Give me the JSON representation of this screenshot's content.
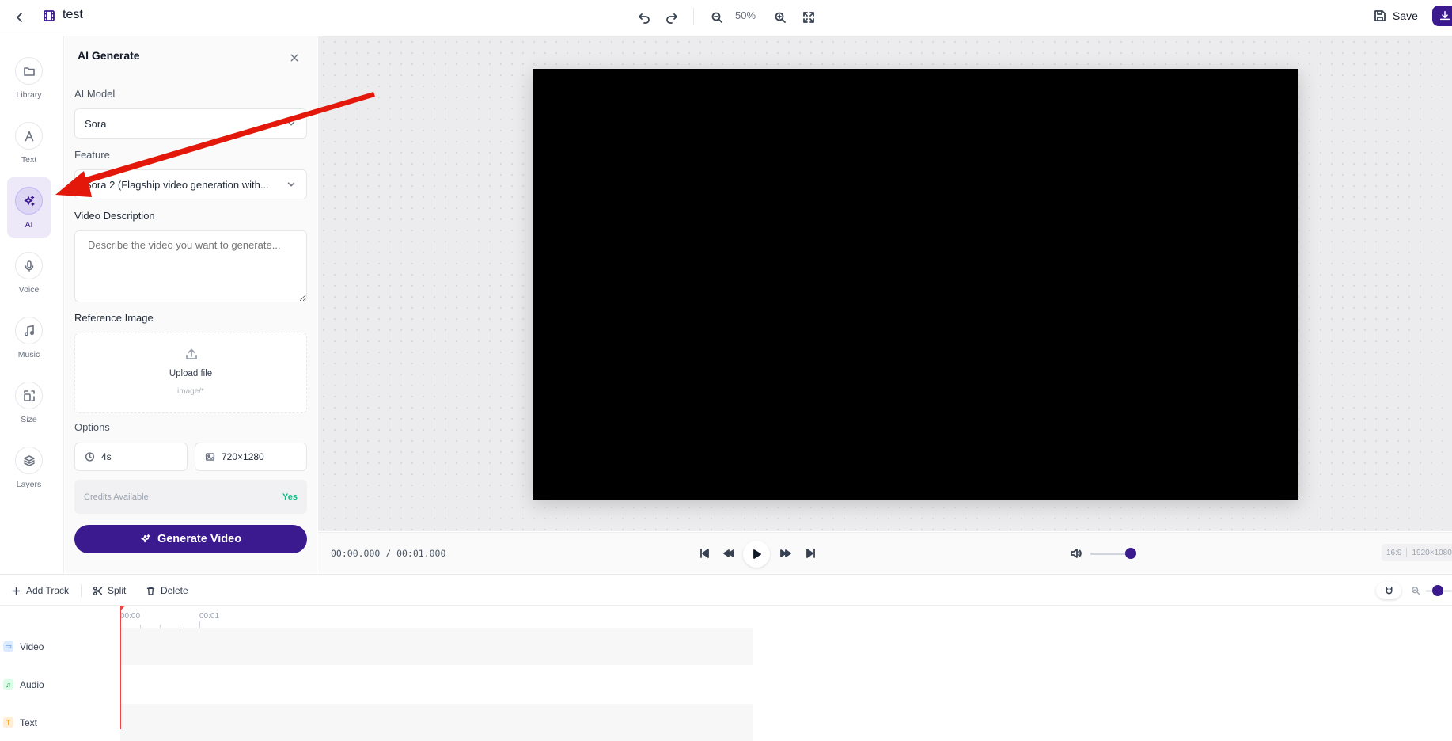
{
  "header": {
    "project_title": "test",
    "zoom": "50%",
    "save_label": "Save"
  },
  "rail": {
    "items": [
      {
        "label": "Library",
        "icon": "folder-icon"
      },
      {
        "label": "Text",
        "icon": "text-icon"
      },
      {
        "label": "AI",
        "icon": "sparkles-icon",
        "active": true
      },
      {
        "label": "Voice",
        "icon": "mic-icon"
      },
      {
        "label": "Music",
        "icon": "music-icon"
      },
      {
        "label": "Size",
        "icon": "resize-icon"
      },
      {
        "label": "Layers",
        "icon": "layers-icon"
      }
    ]
  },
  "panel": {
    "title": "AI Generate",
    "model_label": "AI Model",
    "model_value": "Sora",
    "feature_label": "Feature",
    "feature_value": "Sora 2 (Flagship video generation with...",
    "description_label": "Video Description",
    "description_placeholder": "Describe the video you want to generate...",
    "reference_label": "Reference Image",
    "upload_label": "Upload file",
    "upload_hint": "image/*",
    "options_label": "Options",
    "duration": "4s",
    "resolution": "720×1280",
    "credits_label": "Credits Available",
    "credits_value": "Yes",
    "generate_label": "Generate Video"
  },
  "player": {
    "time": "00:00.000 / 00:01.000",
    "volume_fraction": 0.88,
    "aspect": "16:9",
    "dimensions": "1920×1080"
  },
  "timeline": {
    "add_track": "Add Track",
    "split": "Split",
    "delete": "Delete",
    "ruler": [
      "00:00",
      "00:01"
    ],
    "tracks": [
      {
        "label": "Video",
        "icon": "video-icon"
      },
      {
        "label": "Audio",
        "icon": "music-icon"
      },
      {
        "label": "Text",
        "icon": "text-icon"
      }
    ]
  },
  "colors": {
    "accent": "#3b1a8f",
    "active_bg": "#ede9f8",
    "credits_green": "#10b981",
    "playhead": "#ef4444",
    "annotation_arrow": "#e3170a"
  }
}
